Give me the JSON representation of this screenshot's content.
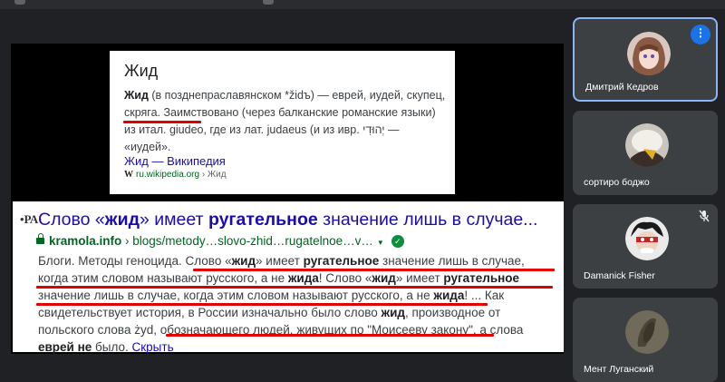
{
  "wiki_card": {
    "title": "Жид",
    "desc_term": "Жид",
    "desc_part1": " (в позднепраславянском *židъ) — еврей, иудей,",
    "desc_underlined": "скупец, скряга",
    "desc_part2": ". Заимствовано (через балканские романские языки) из итал. giudeo, где из лат. judaeus (и из ивр. יְהוּדִי — «иудей».",
    "link_text": "Жид — Википедия",
    "source_logo": "W",
    "source_domain": "ru.wikipedia.org",
    "source_crumb": " › Жид"
  },
  "search_result": {
    "favicon_text": "•РА·",
    "title_prefix": "Слово «",
    "title_term": "жид",
    "title_mid": "» имеет ",
    "title_term2": "ругательное",
    "title_suffix": " значение лишь в случае...",
    "url_domain": "kramola.info",
    "url_path": " › blogs/metody…slovo-zhid…rugatelnoe…v…",
    "shield_glyph": "✓",
    "snippet": {
      "s1": "Блоги. Методы геноцида. ",
      "s2": "Слово «",
      "s3": "жид",
      "s4": "» имеет ",
      "s5": "ругательное",
      "s6": " значение лишь в случае, когда этим словом называют русского, а не ",
      "s7": "жида",
      "s8": "! Слово «",
      "s9": "жид",
      "s10": "» имеет ",
      "s11": "ругательное",
      "s12": " значение лишь в случае, когда этим словом называют русского, а не ",
      "s13": "жида",
      "s14": "! ... Как свидетельствует история, в России изначально было слово ",
      "s15": "жид",
      "s16": ", производное от польского слова żyd, обозначающего людей, живущих по \"Моисееву закону\", а слова ",
      "s17": "еврей не",
      "s18": " было. ",
      "hide_link": "Скрыть"
    }
  },
  "participants": [
    {
      "name": "Дмитрий Кедров",
      "more_label": "⋮"
    },
    {
      "name": "сортиро боджо"
    },
    {
      "name": "Damanick Fisher"
    },
    {
      "name": "Мент Луганский"
    }
  ],
  "colors": {
    "accent": "#8ab4f8",
    "link": "#1a0dab",
    "url_green": "#006621",
    "underline_red": "#e00000"
  }
}
